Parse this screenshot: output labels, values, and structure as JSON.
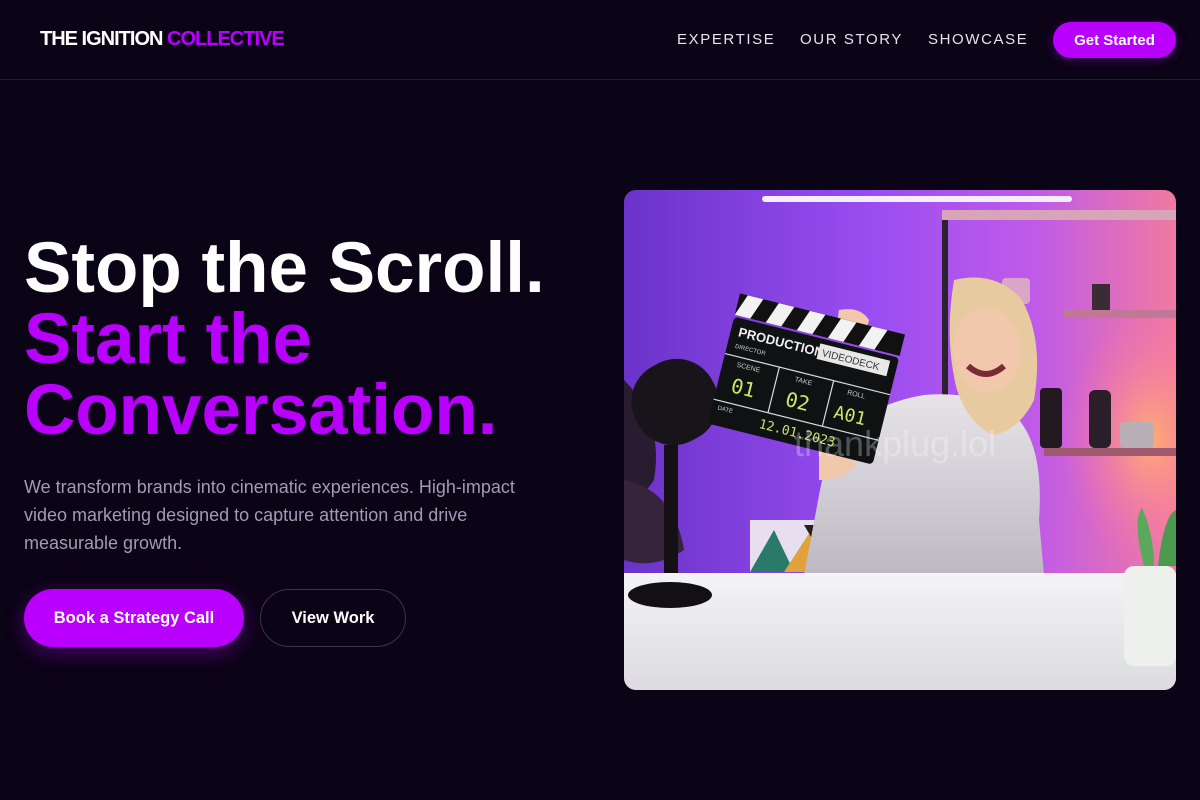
{
  "header": {
    "logo_primary": "THE IGNITION",
    "logo_accent": "COLLECTIVE",
    "nav": [
      {
        "label": "EXPERTISE"
      },
      {
        "label": "OUR STORY"
      },
      {
        "label": "SHOWCASE"
      }
    ],
    "cta_label": "Get Started"
  },
  "hero": {
    "title_line1": "Stop the Scroll.",
    "title_line2": "Start the",
    "title_line3": "Conversation.",
    "description": "We transform brands into cinematic experiences. High-impact video marketing designed to capture attention and drive measurable growth.",
    "primary_button": "Book a Strategy Call",
    "secondary_button": "View Work"
  },
  "image": {
    "clapper_title": "PRODUCTION",
    "clapper_company": "VIDEODECK",
    "clapper_director_label": "DIRECTOR",
    "clapper_scene_label": "SCENE",
    "clapper_take_label": "TAKE",
    "clapper_roll_label": "ROLL",
    "clapper_scene": "01",
    "clapper_take": "02",
    "clapper_roll": "A01",
    "clapper_date_label": "DATE",
    "clapper_date": "12.01.2023",
    "watermark": "thankplug.lol"
  },
  "colors": {
    "background": "#0b0316",
    "accent": "#b900ff",
    "muted_text": "#a19bb4"
  }
}
